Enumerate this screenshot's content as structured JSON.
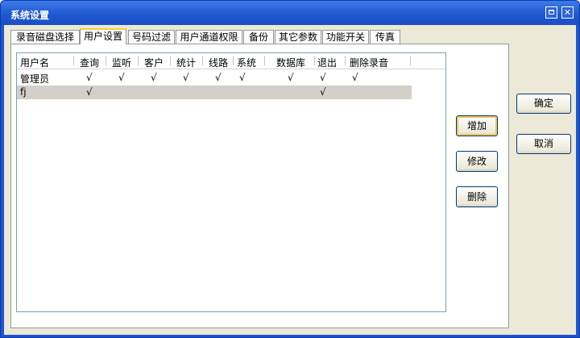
{
  "window": {
    "title": "系统设置",
    "maximize_glyph": "▢",
    "close_glyph": "✕"
  },
  "tabs": [
    {
      "label": "录音磁盘选择",
      "active": false
    },
    {
      "label": "用户设置",
      "active": true
    },
    {
      "label": "号码过滤",
      "active": false
    },
    {
      "label": "用户通道权限",
      "active": false
    },
    {
      "label": "备份",
      "active": false
    },
    {
      "label": "其它参数",
      "active": false
    },
    {
      "label": "功能开关",
      "active": false
    },
    {
      "label": "传真",
      "active": false
    }
  ],
  "table": {
    "columns": [
      "用户名",
      "查询",
      "监听",
      "客户",
      "统计",
      "线路",
      "系统",
      "数据库",
      "退出",
      "删除录音"
    ],
    "rows": [
      {
        "cells": [
          "管理员",
          "√",
          "√",
          "√",
          "√",
          "√",
          "√",
          "√",
          "√",
          "√"
        ],
        "selected": false
      },
      {
        "cells": [
          "fj",
          "√",
          "",
          "",
          "",
          "",
          "",
          "",
          "√",
          ""
        ],
        "selected": true
      }
    ]
  },
  "buttons": {
    "add": "增加",
    "modify": "修改",
    "delete": "删除",
    "ok": "确定",
    "cancel": "取消"
  }
}
